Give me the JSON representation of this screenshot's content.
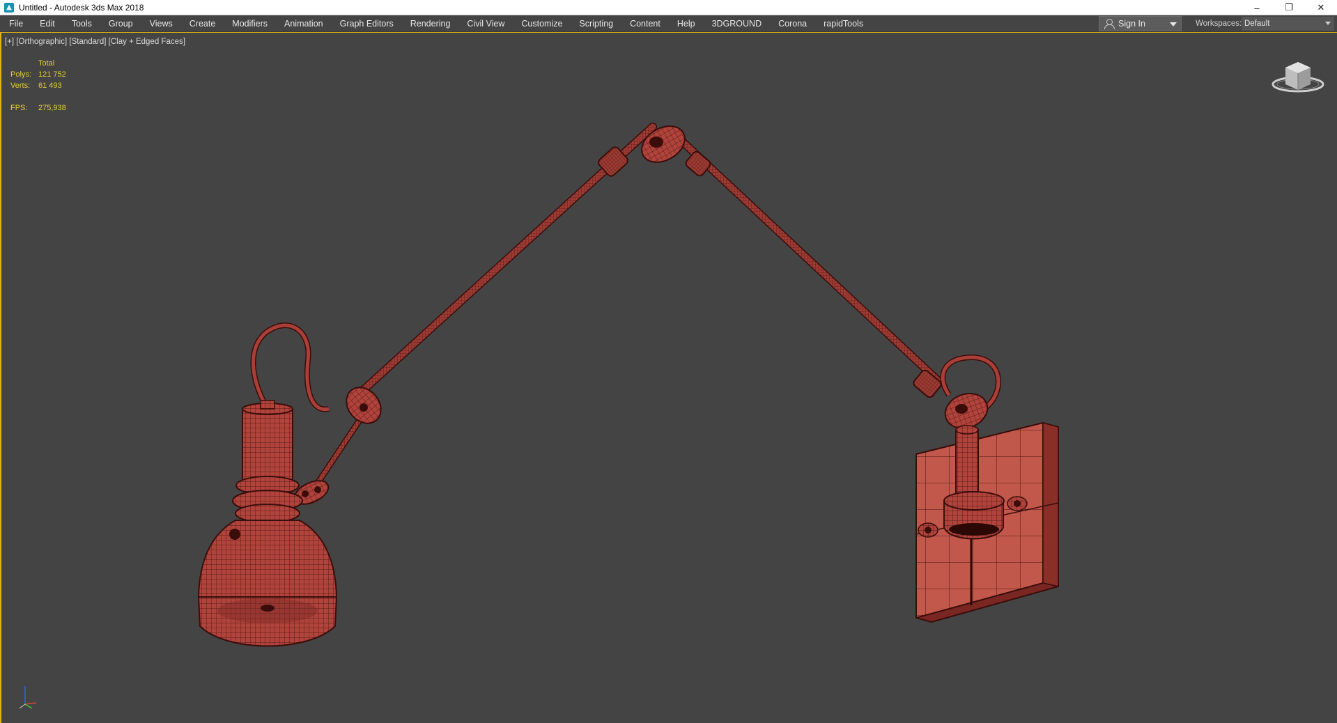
{
  "window": {
    "title": "Untitled - Autodesk 3ds Max 2018",
    "controls": {
      "minimize": "–",
      "restore": "❐",
      "close": "✕"
    }
  },
  "menu": {
    "items": [
      "File",
      "Edit",
      "Tools",
      "Group",
      "Views",
      "Create",
      "Modifiers",
      "Animation",
      "Graph Editors",
      "Rendering",
      "Civil View",
      "Customize",
      "Scripting",
      "Content",
      "Help",
      "3DGROUND",
      "Corona",
      "rapidTools"
    ],
    "sign_in": "Sign In",
    "workspaces_label": "Workspaces:",
    "workspace_value": "Default"
  },
  "viewport": {
    "labels": [
      "[+]",
      "[Orthographic]",
      "[Standard]",
      "[Clay + Edged Faces]"
    ],
    "stats": {
      "header": "Total",
      "polys_label": "Polys:",
      "polys_value": "121 752",
      "verts_label": "Verts:",
      "verts_value": "61 493",
      "fps_label": "FPS:",
      "fps_value": "275,938"
    },
    "viewcube_icon": "viewcube-icon",
    "axis_icon": "axis-tripod-icon"
  },
  "colors": {
    "viewport_bg": "#444444",
    "active_border": "#e2b40f",
    "stats_text": "#e4cc3a",
    "mesh_fill": "#b5463e",
    "mesh_wire": "#3a0d0b"
  }
}
